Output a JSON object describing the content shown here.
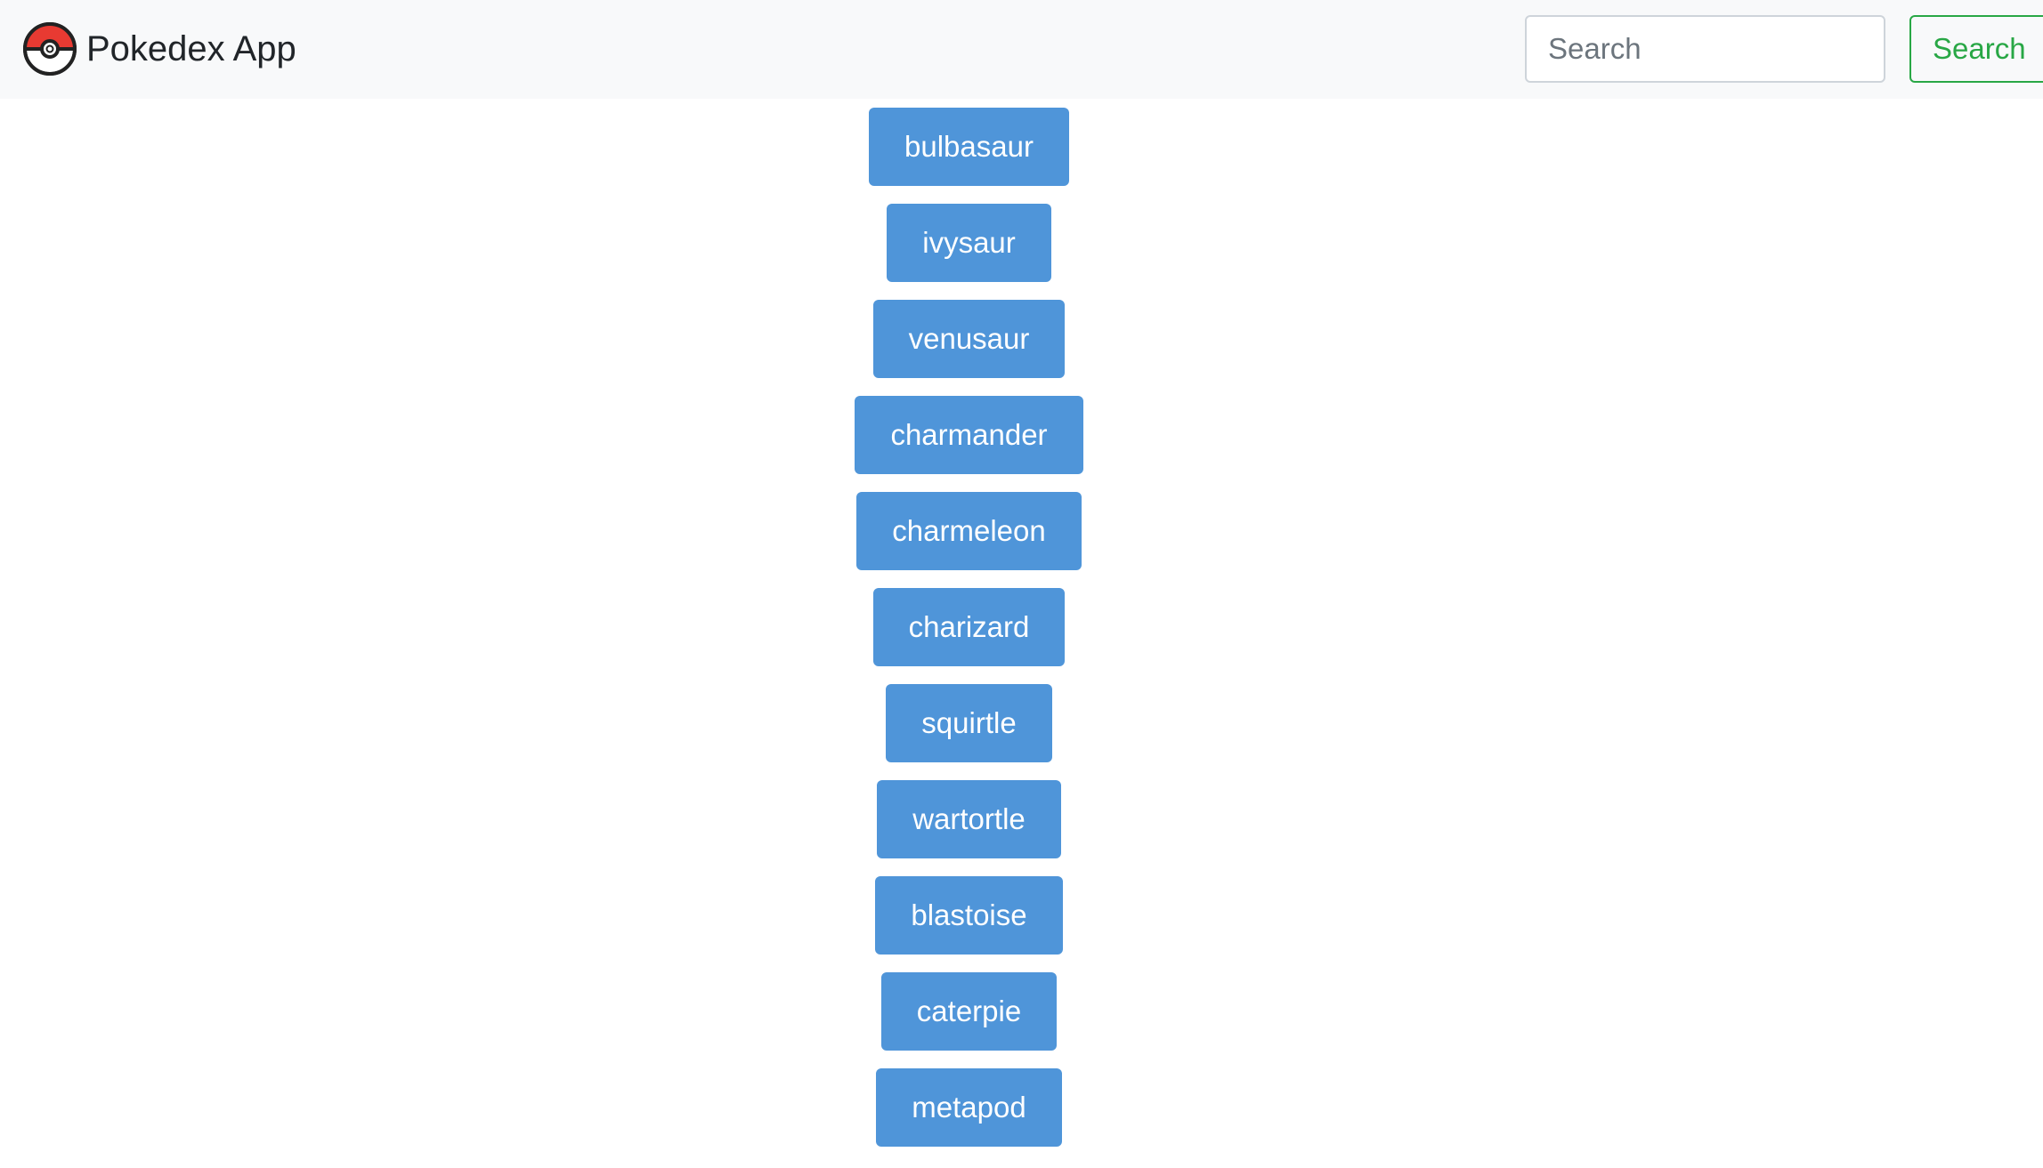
{
  "navbar": {
    "brand_text": "Pokedex App",
    "logo_icon": "pokeball-icon",
    "search": {
      "placeholder": "Search",
      "value": ""
    },
    "search_button_label": "Search"
  },
  "pokemon": [
    {
      "name": "bulbasaur"
    },
    {
      "name": "ivysaur"
    },
    {
      "name": "venusaur"
    },
    {
      "name": "charmander"
    },
    {
      "name": "charmeleon"
    },
    {
      "name": "charizard"
    },
    {
      "name": "squirtle"
    },
    {
      "name": "wartortle"
    },
    {
      "name": "blastoise"
    },
    {
      "name": "caterpie"
    },
    {
      "name": "metapod"
    }
  ],
  "colors": {
    "navbar_bg": "#f8f9fa",
    "pokemon_button_bg": "#4f95d9",
    "search_button_accent": "#28a745",
    "pokeball_red": "#e83a32"
  }
}
